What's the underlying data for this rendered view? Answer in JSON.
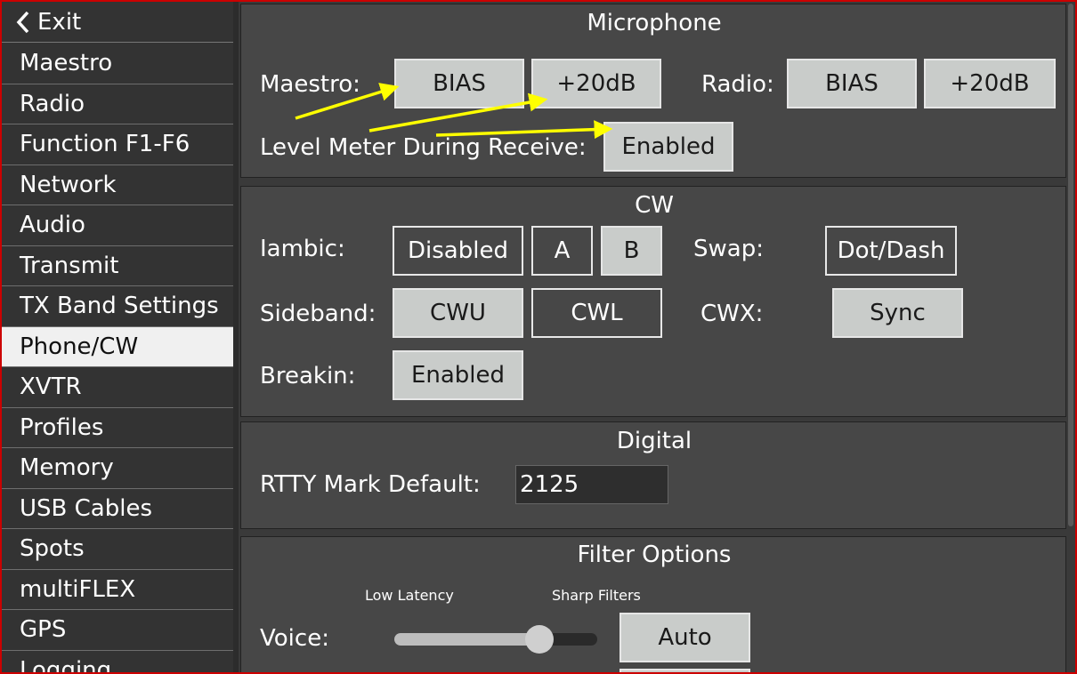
{
  "sidebar": {
    "exit_label": "Exit",
    "items": [
      {
        "label": "Maestro"
      },
      {
        "label": "Radio"
      },
      {
        "label": "Function F1-F6"
      },
      {
        "label": "Network"
      },
      {
        "label": "Audio"
      },
      {
        "label": "Transmit"
      },
      {
        "label": "TX Band Settings"
      },
      {
        "label": "Phone/CW",
        "active": true
      },
      {
        "label": "XVTR"
      },
      {
        "label": "Profiles"
      },
      {
        "label": "Memory"
      },
      {
        "label": "USB Cables"
      },
      {
        "label": "Spots"
      },
      {
        "label": "multiFLEX"
      },
      {
        "label": "GPS"
      },
      {
        "label": "Logging"
      }
    ]
  },
  "microphone": {
    "title": "Microphone",
    "maestro_label": "Maestro:",
    "maestro_bias": "BIAS",
    "maestro_20db": "+20dB",
    "radio_label": "Radio:",
    "radio_bias": "BIAS",
    "radio_20db": "+20dB",
    "level_meter_label": "Level Meter During Receive:",
    "level_meter_value": "Enabled"
  },
  "cw": {
    "title": "CW",
    "iambic_label": "Iambic:",
    "iambic_disabled": "Disabled",
    "iambic_a": "A",
    "iambic_b": "B",
    "swap_label": "Swap:",
    "swap_value": "Dot/Dash",
    "sideband_label": "Sideband:",
    "sideband_cwu": "CWU",
    "sideband_cwl": "CWL",
    "cwx_label": "CWX:",
    "cwx_value": "Sync",
    "breakin_label": "Breakin:",
    "breakin_value": "Enabled"
  },
  "digital": {
    "title": "Digital",
    "rtty_label": "RTTY Mark Default:",
    "rtty_value": "2125"
  },
  "filter": {
    "title": "Filter Options",
    "low_latency": "Low Latency",
    "sharp_filters": "Sharp Filters",
    "voice_label": "Voice:",
    "voice_auto": "Auto",
    "voice_slider_level": 0.75
  },
  "colors": {
    "button_on": "#c9ccca",
    "panel_bg": "#474747",
    "annotation_arrow": "#ffff00",
    "frame_border": "#cc0000"
  },
  "icons": {
    "exit": "chevron-left-icon"
  }
}
